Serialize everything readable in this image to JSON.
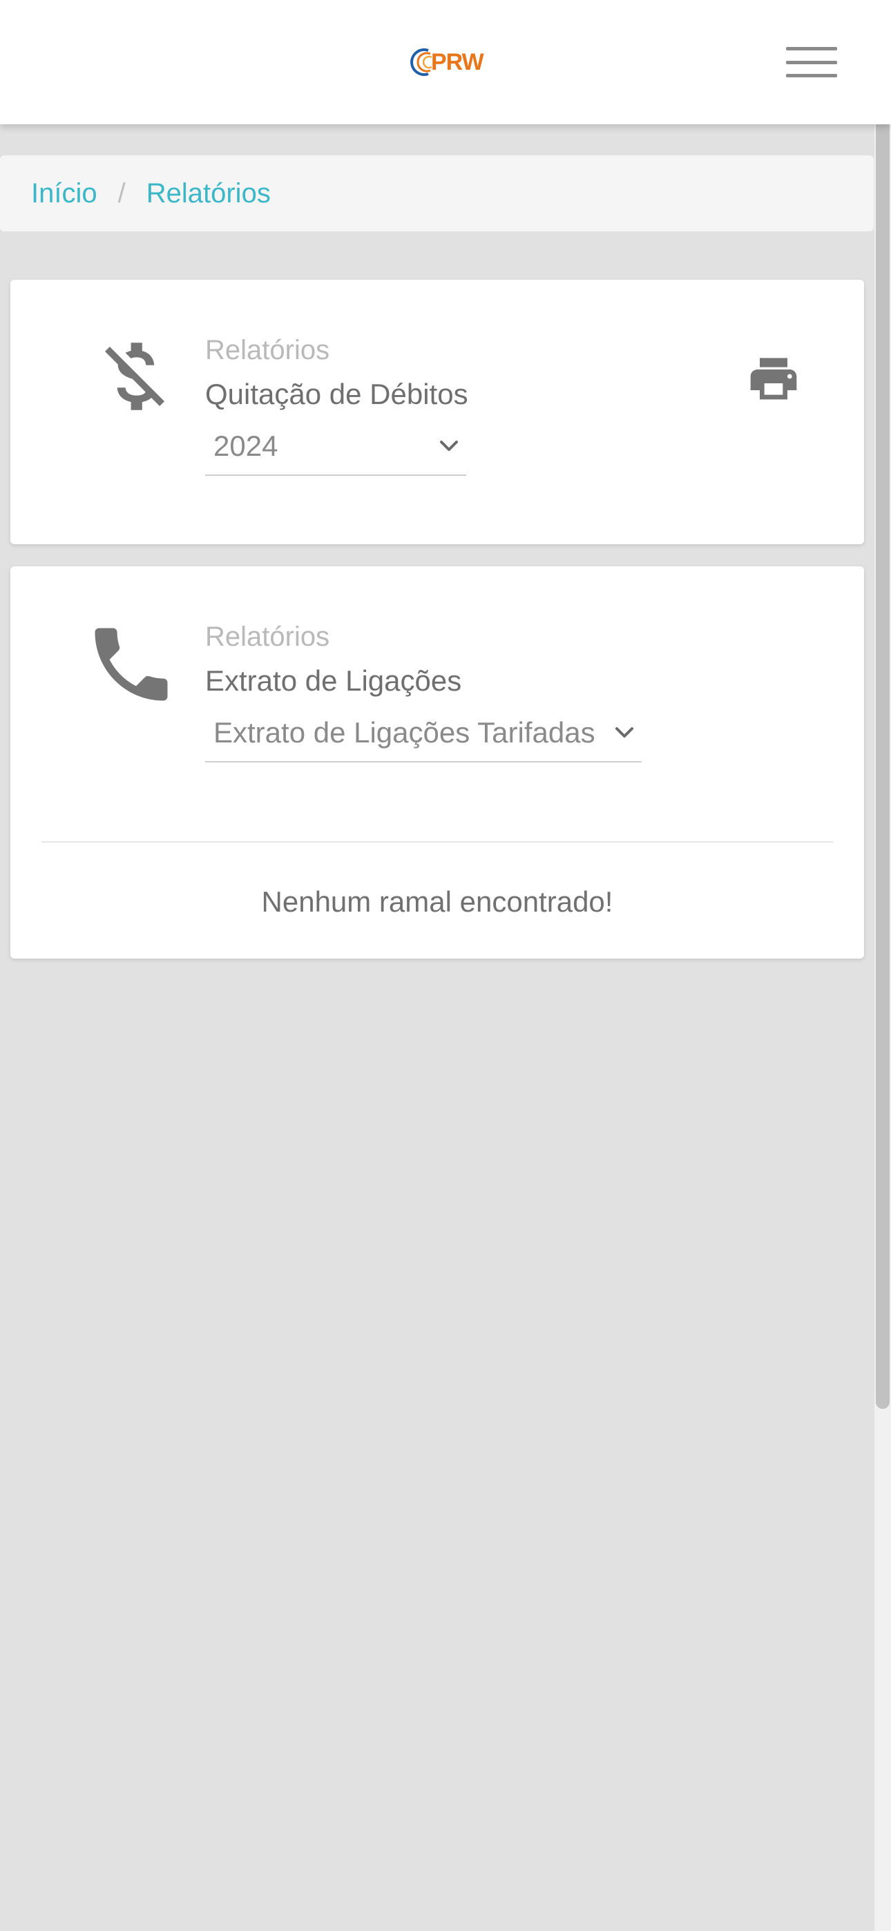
{
  "header": {
    "logo_text": "PRW",
    "menu_icon": "hamburger-menu-icon"
  },
  "breadcrumb": {
    "items": [
      {
        "label": "Início"
      },
      {
        "label": "Relatórios"
      }
    ],
    "separator": "/"
  },
  "cards": [
    {
      "subtitle": "Relatórios",
      "title": "Quitação de Débitos",
      "icon": "money-off-icon",
      "select": {
        "value": "2024"
      },
      "action_icon": "print-icon"
    },
    {
      "subtitle": "Relatórios",
      "title": "Extrato de Ligações",
      "icon": "phone-icon",
      "select": {
        "value": "Extrato de Ligações Tarifadas"
      },
      "empty_message": "Nenhum ramal encontrado!"
    }
  ],
  "colors": {
    "accent": "#3bb7c8",
    "logo_orange": "#e8761a",
    "logo_blue": "#1e5fa8",
    "icon_gray": "#757575",
    "background": "#e1e1e1"
  }
}
